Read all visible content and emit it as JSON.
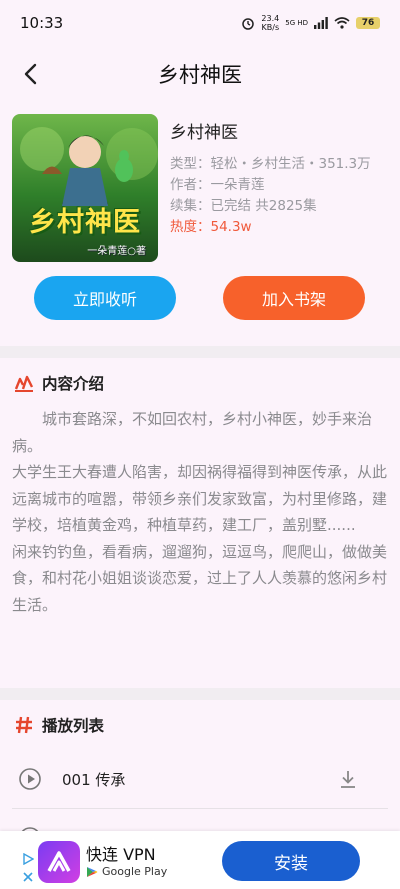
{
  "status_bar": {
    "time": "10:33",
    "net_speed_value": "23.4",
    "net_speed_unit": "KB/s",
    "signal_label": "5G HD",
    "battery": "76"
  },
  "header": {
    "title": "乡村神医"
  },
  "book": {
    "name": "乡村神医",
    "cover_title": "乡村神医",
    "cover_author": "一朵青莲○著",
    "type_line": "类型：轻松・乡村生活・351.3万",
    "author_line": "作者：一朵青莲",
    "serial_line": "续集：已完结 共2825集",
    "hot_label": "热度：",
    "hot_value": "54.3w"
  },
  "actions": {
    "listen": "立即收听",
    "add_shelf": "加入书架"
  },
  "intro": {
    "title": "内容介绍",
    "paragraphs": [
      "　　城市套路深，不如回农村，乡村小神医，妙手来治病。",
      "大学生王大春遭人陷害，却因祸得福得到神医传承，从此远离城市的喧嚣，带领乡亲们发家致富，为村里修路，建学校，培植黄金鸡，种植草药，建工厂，盖别墅......",
      "闲来钓钓鱼，看看病，遛遛狗，逗逗鸟，爬爬山，做做美食，和村花小姐姐谈谈恋爱，过上了人人羡慕的悠闲乡村生活。"
    ]
  },
  "playlist": {
    "title": "播放列表",
    "episodes": [
      {
        "title": "001 传承"
      }
    ]
  },
  "ad": {
    "app_name": "快连 VPN",
    "store": "Google Play",
    "install": "安装"
  },
  "colors": {
    "accent_blue": "#1aa5f0",
    "accent_orange": "#f7612b",
    "hot_red": "#f05a3c",
    "panel_bg": "#fcf3fb",
    "ad_button": "#1a5fd0"
  }
}
